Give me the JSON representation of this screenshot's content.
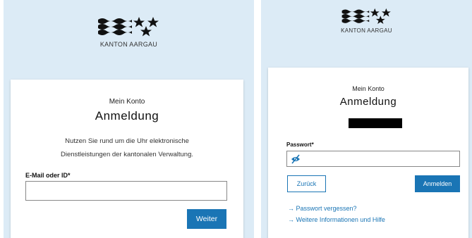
{
  "left": {
    "logo_text": "KANTON AARGAU",
    "subtitle": "Mein Konto",
    "title": "Anmeldung",
    "description_line1": "Nutzen Sie rund um die Uhr elektronische",
    "description_line2": "Dienstleistungen der kantonalen Verwaltung.",
    "email_label": "E-Mail oder ID*",
    "email_value": "",
    "next_button": "Weiter"
  },
  "right": {
    "logo_text": "KANTON AARGAU",
    "subtitle": "Mein Konto",
    "title": "Anmeldung",
    "password_label": "Passwort*",
    "password_value": "",
    "back_button": "Zurück",
    "login_button": "Anmelden",
    "forgot_link": "→ Passwort vergessen?",
    "info_link": "→ Weitere Informationen und Hilfe"
  },
  "colors": {
    "header_background": "#dcebf6",
    "primary": "#1a75b5"
  },
  "icons": {
    "logo": "canton-aargau-logo-icon",
    "password_toggle": "eye-slash-icon"
  }
}
